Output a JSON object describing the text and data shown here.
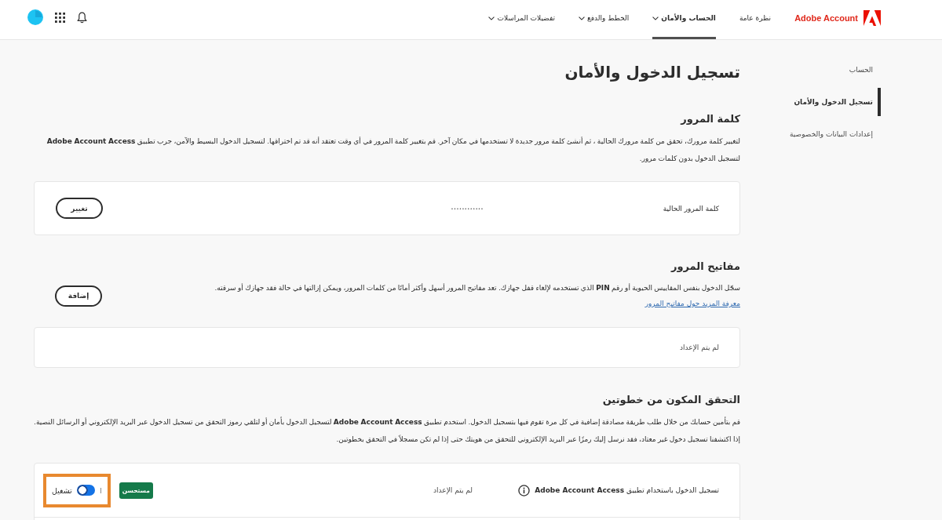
{
  "top_bar": {
    "brand": "Adobe Account",
    "nav": [
      {
        "label": "نظرة عامة",
        "selected": false,
        "dropdown": false
      },
      {
        "label": "الحساب والأمان",
        "selected": true,
        "dropdown": true
      },
      {
        "label": "الخطط والدفع",
        "selected": false,
        "dropdown": true
      },
      {
        "label": "تفضيلات المراسلات",
        "selected": false,
        "dropdown": true
      }
    ]
  },
  "sidebar": {
    "items": [
      {
        "label": "الحساب",
        "selected": false
      },
      {
        "label": "تسجيل الدخول والأمان",
        "selected": true
      },
      {
        "label": "إعدادات البيانات والخصوصية",
        "selected": false
      }
    ]
  },
  "page_title": "تسجيل الدخول والأمان",
  "password": {
    "heading": "كلمة المرور",
    "description": "لتغيير كلمة مرورك، تحقق من كلمة مرورك الحالية ، ثم أنشئ كلمة مرور جديدة لا تستخدمها في مكان آخر. قم بتغيير كلمة المرور في أي وقت تعتقد أنه قد تم اختراقها. لتسجيل الدخول البسيط والآمن، جرب تطبيق **Adobe Account Access** لتسجيل الدخول بدون كلمات مرور.",
    "card": {
      "label": "كلمة المرور الحالية",
      "value": "••••••••••••",
      "button": "تغيير"
    }
  },
  "passkeys": {
    "heading": "مفاتيح المرور",
    "description": "سجّل الدخول بنفس المقاييس الحيوية أو رقم **PIN** الذي تستخدمه لإلغاء قفل جهازك. تعد مفاتيح المرور أسهل وأكثر أمانًا من كلمات المرور، ويمكن إزالتها في حالة فقد جهازك أو سرقته.",
    "link": "معرفة المزيد حول مفاتيح المرور",
    "button": "إضافة",
    "card": {
      "status": "لم يتم الإعداد"
    }
  },
  "two_step": {
    "heading": "التحقق المكون من خطوتين",
    "description": "قم بتأمين حسابك من خلال طلب طريقة مصادقة إضافية في كل مرة تقوم فيها بتسجيل الدخول. استخدم تطبيق **Adobe Account Access** لتسجيل الدخول بأمان أو لتلقي رموز التحقق من تسجيل الدخول عبر البريد الإلكتروني أو الرسائل النصية. إذا اكتشفنا تسجيل دخول غير معتاد، فقد نرسل إليك رمزًا عبر البريد الإلكتروني للتحقق من هويتك حتى إذا لم تكن مسجلاً في التحقق بخطوتين.",
    "rows": [
      {
        "label": "تسجيل الدخول باستخدام تطبيق **Adobe Account Access**",
        "status": "لم يتم الإعداد",
        "badge": "مستحسن",
        "highlighted": true,
        "toggle": {
          "on": true,
          "label": "تشغيل"
        }
      }
    ]
  }
}
